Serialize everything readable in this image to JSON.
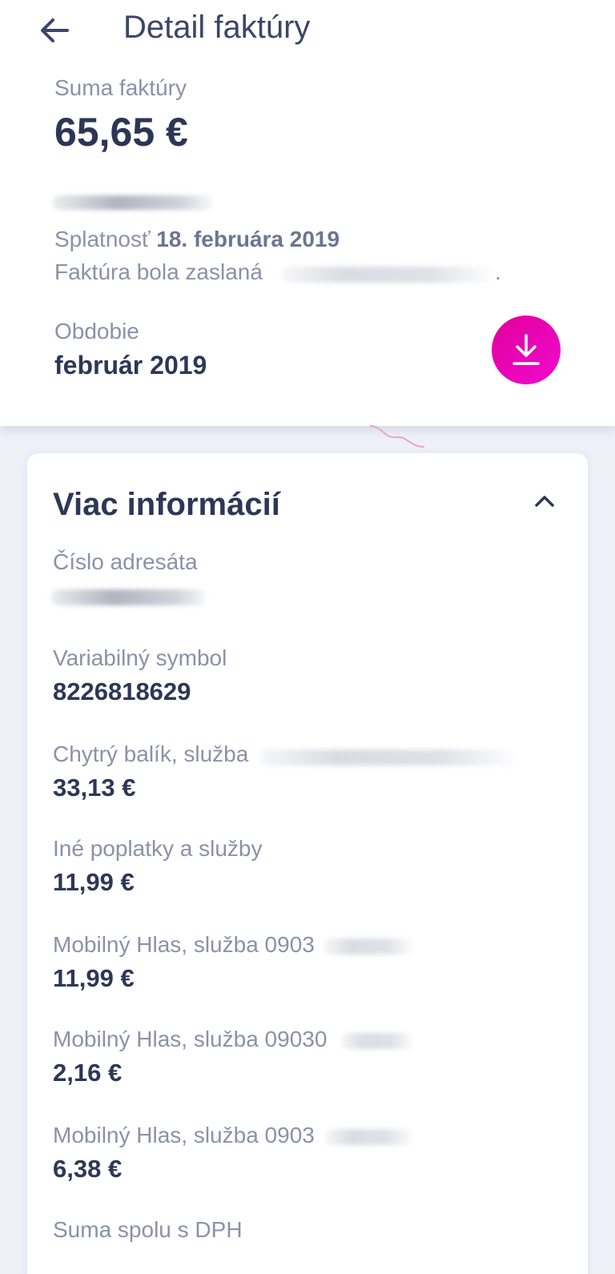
{
  "header": {
    "title": "Detail faktúry",
    "back_icon": "arrow-left-icon"
  },
  "summary": {
    "sum_label": "Suma faktúry",
    "sum_value": "65,65 €",
    "due_prefix": "Splatnosť",
    "due_date": "18. februára 2019",
    "sent_text": "Faktúra bola zaslaná",
    "sent_suffix": ".",
    "period_label": "Obdobie",
    "period_value": "február 2019",
    "download_icon": "download-icon",
    "download_color": "#e6009f"
  },
  "more_info": {
    "title": "Viac informácií",
    "chevron_icon": "chevron-up-icon",
    "rows": [
      {
        "label": "Číslo adresáta",
        "value": ""
      },
      {
        "label": "Variabilný symbol",
        "value": "8226818629"
      },
      {
        "label": "Chytrý balík, služba",
        "value": "33,13 €"
      },
      {
        "label": "Iné poplatky a služby",
        "value": "11,99 €"
      },
      {
        "label": "Mobilný Hlas, služba 0903",
        "value": "11,99 €"
      },
      {
        "label": "Mobilný Hlas, služba 09030",
        "value": "2,16 €"
      },
      {
        "label": "Mobilný Hlas, služba 0903",
        "value": "6,38 €"
      },
      {
        "label": "Suma spolu s DPH",
        "value": ""
      }
    ]
  }
}
